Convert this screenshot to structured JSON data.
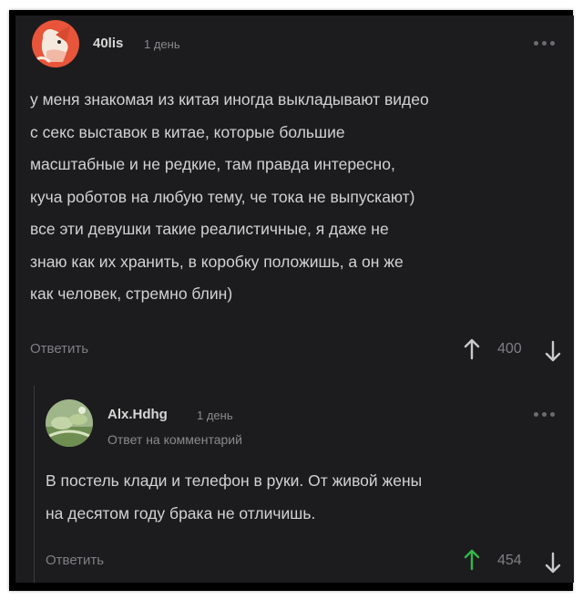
{
  "comment": {
    "username": "40lis",
    "time": "1 день",
    "text": "у меня знакомая из китая иногда выкладывают видео\nс секс выставок в китае, которые большие\nмасштабные и не редкие, там правда интересно,\nкуча роботов на любую тему, че тока не выпускают)\nвсе эти девушки такие реалистичные, я даже не\nзнаю как их хранить, в коробку положишь, а он же\nкак человек, стремно блин)",
    "reply_label": "Ответить",
    "score": "400",
    "up_icon": "arrow-up-icon",
    "down_icon": "arrow-down-icon",
    "up_color": "#c9c9cc"
  },
  "reply": {
    "username": "Alx.Hdhg",
    "time": "1 день",
    "reply_to": "Ответ на комментарий",
    "text": "В постель клади и телефон в руки. От живой жены\nна десятом году брака не отличишь.",
    "reply_label": "Ответить",
    "score": "454",
    "up_icon": "arrow-up-icon",
    "down_icon": "arrow-down-icon",
    "up_color": "#31b84a"
  }
}
